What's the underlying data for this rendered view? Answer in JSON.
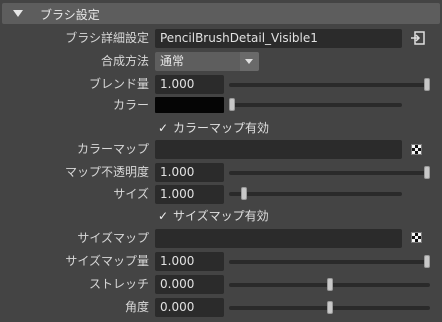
{
  "section": {
    "title": "ブラシ設定"
  },
  "rows": {
    "brush_detail": {
      "label": "ブラシ詳細設定",
      "value": "PencilBrushDetail_Visible1"
    },
    "blend_method": {
      "label": "合成方法",
      "value": "通常"
    },
    "blend_amount": {
      "label": "ブレンド量",
      "value": "1.000",
      "slider": 1.0
    },
    "color": {
      "label": "カラー",
      "slider": 0.0
    },
    "color_map_enable": {
      "label": "カラーマップ有効",
      "checked": true
    },
    "color_map": {
      "label": "カラーマップ",
      "value": ""
    },
    "map_opacity": {
      "label": "マップ不透明度",
      "value": "1.000",
      "slider": 1.0
    },
    "size": {
      "label": "サイズ",
      "value": "1.000",
      "slider": 0.07
    },
    "size_map_enable": {
      "label": "サイズマップ有効",
      "checked": true
    },
    "size_map": {
      "label": "サイズマップ",
      "value": ""
    },
    "size_map_amount": {
      "label": "サイズマップ量",
      "value": "1.000",
      "slider": 1.0
    },
    "stretch": {
      "label": "ストレッチ",
      "value": "0.000",
      "slider": 0.5
    },
    "angle": {
      "label": "角度",
      "value": "0.000",
      "slider": 0.5
    }
  },
  "icons": {
    "section_toggle": "collapse-triangle-icon",
    "export": "export-icon",
    "texture": "checker-texture-icon",
    "check": "checkmark-icon"
  },
  "checkmark_glyph": "✓",
  "colors": {
    "background": "#444444",
    "field": "#2b2b2b",
    "header": "#5d5d5d",
    "color_value": "#050505"
  }
}
